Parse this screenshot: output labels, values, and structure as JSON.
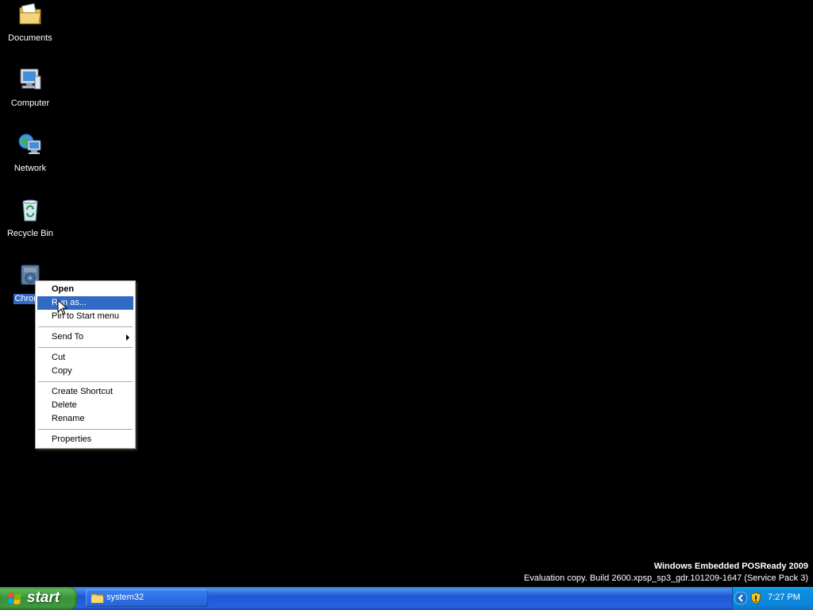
{
  "desktop": {
    "icons": [
      {
        "label": "Documents",
        "icon": "documents-folder-icon"
      },
      {
        "label": "Computer",
        "icon": "computer-icon"
      },
      {
        "label": "Network",
        "icon": "network-icon"
      },
      {
        "label": "Recycle Bin",
        "icon": "recycle-bin-icon"
      },
      {
        "label": "Chrome",
        "icon": "chrome-installer-icon",
        "selected": true
      }
    ]
  },
  "context_menu": {
    "items": [
      {
        "label": "Open",
        "default": true
      },
      {
        "label": "Run as...",
        "highlighted": true
      },
      {
        "label": "Pin to Start menu"
      },
      {
        "label": "Send To",
        "submenu": true
      },
      {
        "label": "Cut"
      },
      {
        "label": "Copy"
      },
      {
        "label": "Create Shortcut"
      },
      {
        "label": "Delete"
      },
      {
        "label": "Rename"
      },
      {
        "label": "Properties"
      }
    ]
  },
  "watermark": {
    "title": "Windows Embedded POSReady 2009",
    "subtitle": "Evaluation copy. Build 2600.xpsp_sp3_gdr.101209-1647 (Service Pack 3)"
  },
  "taskbar": {
    "start_label": "start",
    "task_button_label": "system32",
    "clock": "7:27 PM"
  },
  "colors": {
    "selection": "#316ac5",
    "taskbar_blue": "#2157d7",
    "start_green": "#379337",
    "tray_blue": "#0c83d8"
  }
}
